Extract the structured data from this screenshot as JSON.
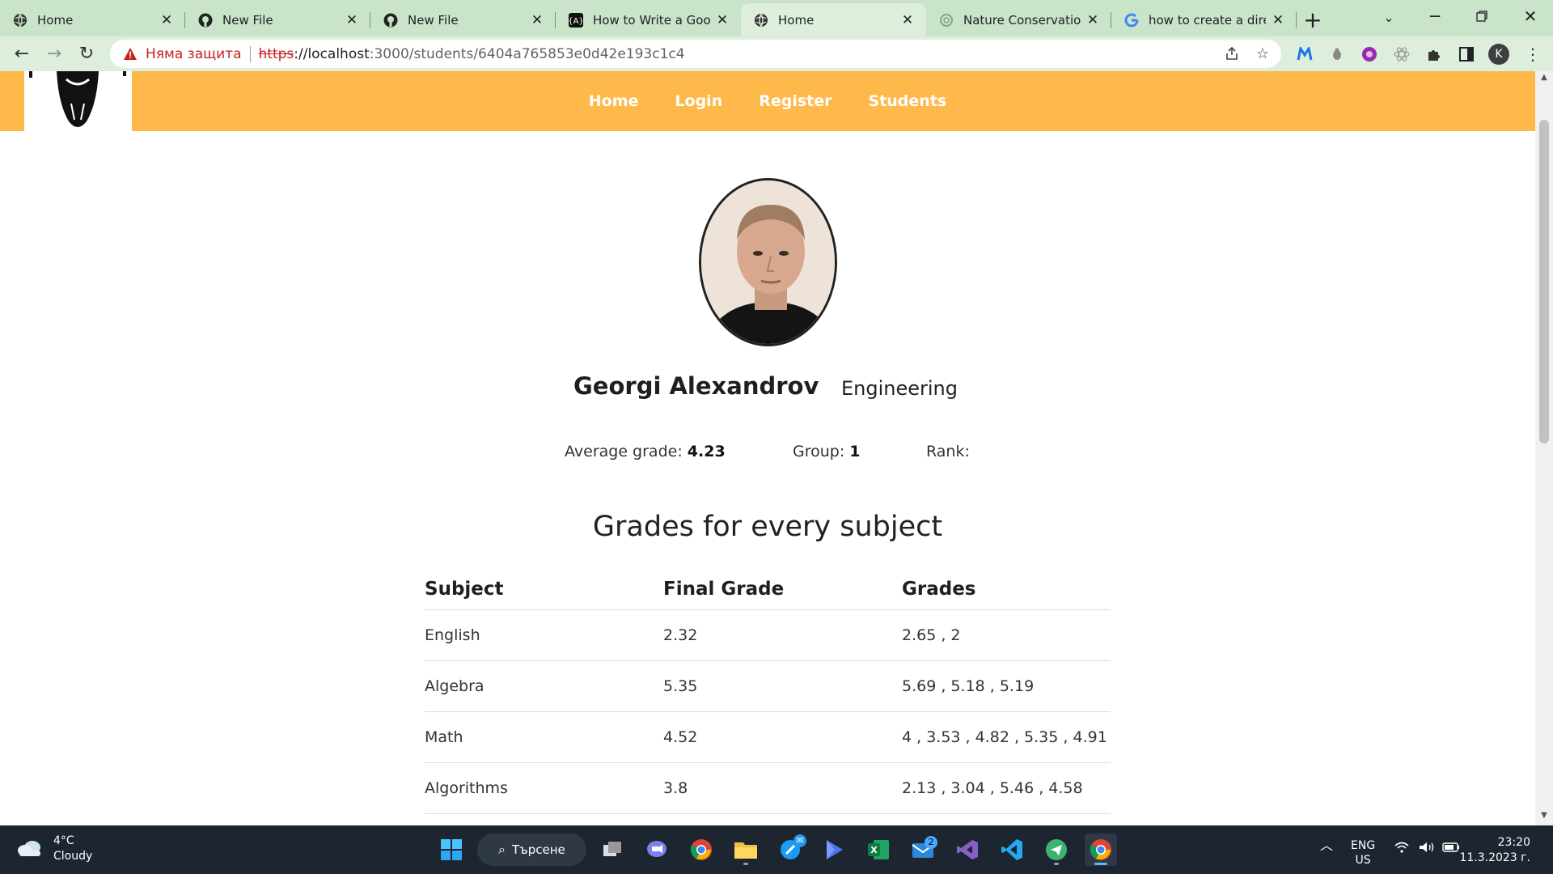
{
  "browser": {
    "tabs": [
      {
        "title": "Home",
        "icon": "globe-icon",
        "active": false
      },
      {
        "title": "New File",
        "icon": "github-icon",
        "active": false
      },
      {
        "title": "New File",
        "icon": "github-icon",
        "active": false
      },
      {
        "title": "How to Write a Good",
        "icon": "code-icon",
        "active": false
      },
      {
        "title": "Home",
        "icon": "globe-icon",
        "active": true
      },
      {
        "title": "Nature Conservation",
        "icon": "openai-icon",
        "active": false
      },
      {
        "title": "how to create a direct",
        "icon": "google-icon",
        "active": false
      }
    ],
    "address": {
      "security_label": "Няма защита",
      "scheme": "https",
      "host_and_sep": "://localhost",
      "path": ":3000/students/6404a765853e0d42e193c1c4"
    },
    "profile_initial": "K"
  },
  "site": {
    "nav": {
      "home": "Home",
      "login": "Login",
      "register": "Register",
      "students": "Students"
    },
    "student": {
      "name": "Georgi Alexandrov",
      "major": "Engineering",
      "average_label": "Average grade:",
      "average_value": "4.23",
      "group_label": "Group:",
      "group_value": "1",
      "rank_label": "Rank:",
      "rank_value": ""
    },
    "grades": {
      "title": "Grades for every subject",
      "headers": [
        "Subject",
        "Final Grade",
        "Grades"
      ],
      "rows": [
        {
          "subject": "English",
          "final": "2.32",
          "grades": "2.65 , 2"
        },
        {
          "subject": "Algebra",
          "final": "5.35",
          "grades": "5.69 , 5.18 , 5.19"
        },
        {
          "subject": "Math",
          "final": "4.52",
          "grades": "4 , 3.53 , 4.82 , 5.35 , 4.91"
        },
        {
          "subject": "Algorithms",
          "final": "3.8",
          "grades": "2.13 , 3.04 , 5.46 , 4.58"
        }
      ]
    }
  },
  "taskbar": {
    "weather_temp": "4°C",
    "weather_desc": "Cloudy",
    "search_label": "Търсене",
    "mail_badge": "2",
    "lang_top": "ENG",
    "lang_bottom": "US",
    "time": "23:20",
    "date": "11.3.2023 г."
  }
}
